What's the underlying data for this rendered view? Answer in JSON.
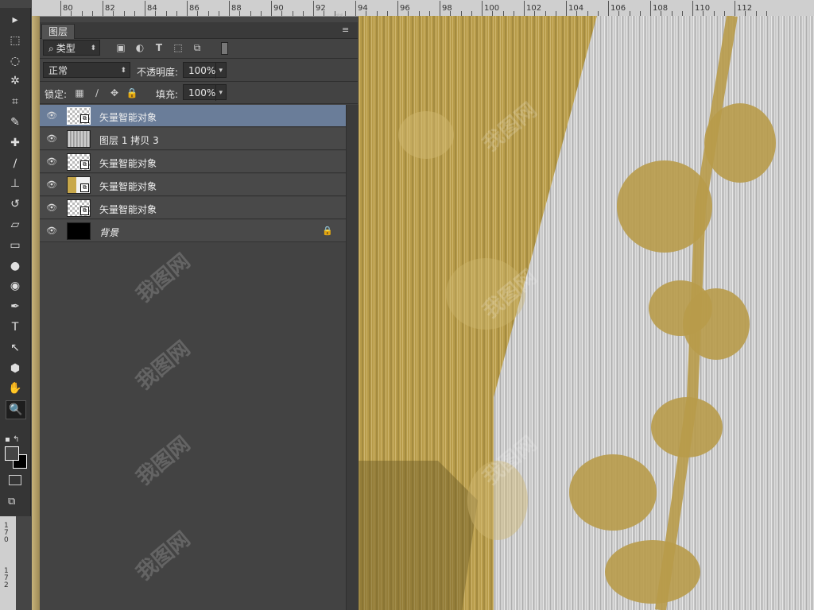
{
  "ruler": {
    "top_labels": [
      "80",
      "82",
      "84",
      "86",
      "88",
      "90",
      "92",
      "94",
      "96",
      "98",
      "100",
      "102",
      "104",
      "106",
      "108",
      "110",
      "112"
    ],
    "left_labels": [
      "1",
      "7",
      "0",
      "1",
      "7",
      "2"
    ]
  },
  "tools": [
    {
      "name": "move-tool-icon",
      "glyph": "▸"
    },
    {
      "name": "marquee-tool-icon",
      "glyph": "⬚"
    },
    {
      "name": "lasso-tool-icon",
      "glyph": "◌"
    },
    {
      "name": "magic-wand-icon",
      "glyph": "✲"
    },
    {
      "name": "crop-tool-icon",
      "glyph": "⌗"
    },
    {
      "name": "eyedropper-icon",
      "glyph": "✎"
    },
    {
      "name": "healing-brush-icon",
      "glyph": "✚"
    },
    {
      "name": "brush-tool-icon",
      "glyph": "∕"
    },
    {
      "name": "clone-stamp-icon",
      "glyph": "⊥"
    },
    {
      "name": "history-brush-icon",
      "glyph": "↺"
    },
    {
      "name": "eraser-icon",
      "glyph": "▱"
    },
    {
      "name": "gradient-tool-icon",
      "glyph": "▭"
    },
    {
      "name": "blur-tool-icon",
      "glyph": "●"
    },
    {
      "name": "dodge-tool-icon",
      "glyph": "◉"
    },
    {
      "name": "pen-tool-icon",
      "glyph": "✒"
    },
    {
      "name": "type-tool-icon",
      "glyph": "T"
    },
    {
      "name": "path-selection-icon",
      "glyph": "↖"
    },
    {
      "name": "shape-tool-icon",
      "glyph": "⬢"
    },
    {
      "name": "hand-tool-icon",
      "glyph": "✋"
    },
    {
      "name": "zoom-tool-icon",
      "glyph": "🔍"
    }
  ],
  "panel": {
    "tab_label": "图层",
    "filter_label": "类型",
    "blend_mode": "正常",
    "opacity_label": "不透明度:",
    "opacity_value": "100%",
    "lock_label": "锁定:",
    "fill_label": "填充:",
    "fill_value": "100%"
  },
  "layers": [
    {
      "name": "矢量智能对象",
      "thumb": "checker",
      "smart": true,
      "selected": true,
      "locked": false
    },
    {
      "name": "图层 1 拷贝 3",
      "thumb": "wood",
      "smart": false,
      "selected": false,
      "locked": false
    },
    {
      "name": "矢量智能对象",
      "thumb": "checker",
      "smart": true,
      "selected": false,
      "locked": false
    },
    {
      "name": "矢量智能对象",
      "thumb": "photo",
      "smart": true,
      "selected": false,
      "locked": false
    },
    {
      "name": "矢量智能对象",
      "thumb": "checker",
      "smart": true,
      "selected": false,
      "locked": false
    },
    {
      "name": "背景",
      "thumb": "black",
      "smart": false,
      "selected": false,
      "locked": true
    }
  ],
  "watermark": "我图网",
  "colors": {
    "selected_layer": "#6a7d99",
    "wood_gold": "#b89c4a",
    "wood_gray": "#c8c8c8"
  }
}
